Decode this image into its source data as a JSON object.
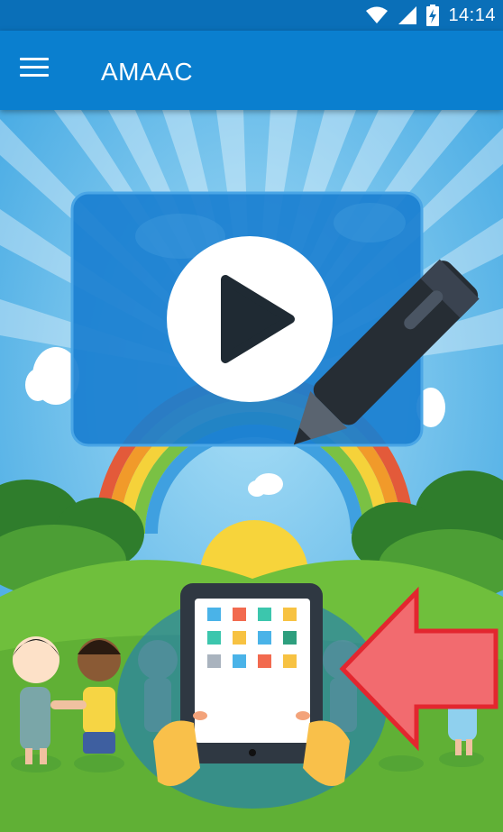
{
  "status_bar": {
    "time": "14:14",
    "icons": [
      "wifi-icon",
      "cell-signal-icon",
      "battery-charging-icon"
    ]
  },
  "app_bar": {
    "title": "AMAAC",
    "menu_icon": "hamburger-menu-icon"
  },
  "hero": {
    "video_card_icon": "play-icon",
    "pen_icon": "stylus-pen-icon",
    "tablet_icon": "tablet-icon",
    "arrow_icon": "left-arrow-icon",
    "colors": {
      "sky": "#6ec6f0",
      "card": "#1a7fd0",
      "arrow": "#f26b6f",
      "arrow_border": "#e3262f",
      "grass": "#6fbf3c"
    }
  }
}
